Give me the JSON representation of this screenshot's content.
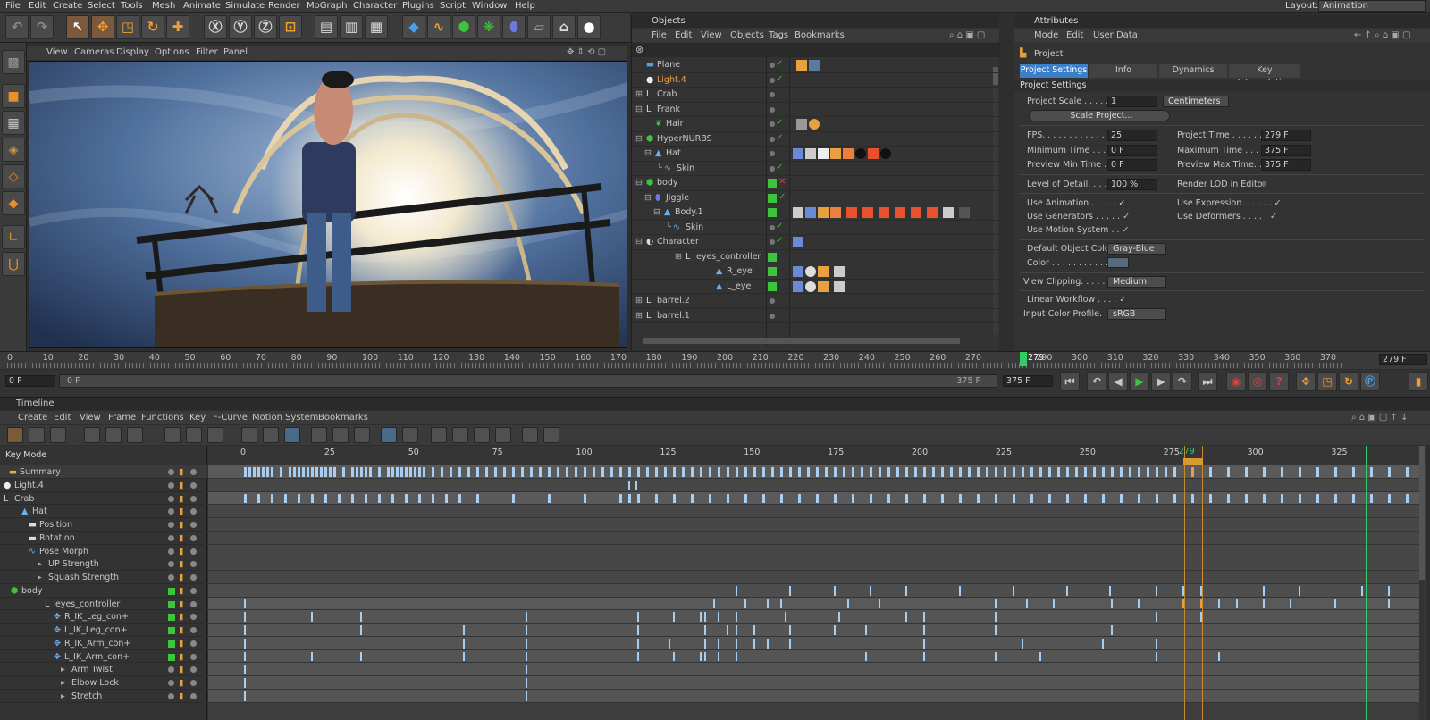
{
  "menu": {
    "items": [
      "File",
      "Edit",
      "Create",
      "Select",
      "Tools",
      "Mesh",
      "Animate",
      "Simulate",
      "Render",
      "MoGraph",
      "Character",
      "Plugins",
      "Script",
      "Window",
      "Help"
    ],
    "layout_label": "Layout:",
    "layout_value": "Animation"
  },
  "viewport": {
    "menu": [
      "View",
      "Cameras",
      "Display",
      "Options",
      "Filter",
      "Panel"
    ]
  },
  "objects": {
    "title": "Objects",
    "menu": [
      "File",
      "Edit",
      "View",
      "Objects",
      "Tags",
      "Bookmarks"
    ],
    "rows": [
      {
        "name": "Plane"
      },
      {
        "name": "Light.4"
      },
      {
        "name": "Crab"
      },
      {
        "name": "Frank"
      },
      {
        "name": "Hair"
      },
      {
        "name": "HyperNURBS"
      },
      {
        "name": "Hat"
      },
      {
        "name": "Skin"
      },
      {
        "name": "body"
      },
      {
        "name": "Jiggle"
      },
      {
        "name": "Body.1"
      },
      {
        "name": "Skin"
      },
      {
        "name": "Character"
      },
      {
        "name": "eyes_controller"
      },
      {
        "name": "R_eye"
      },
      {
        "name": "L_eye"
      },
      {
        "name": "barrel.2"
      },
      {
        "name": "barrel.1"
      }
    ]
  },
  "attributes": {
    "title": "Attributes",
    "menu": [
      "Mode",
      "Edit",
      "User Data"
    ],
    "object": "Project",
    "tabs": [
      "Project Settings",
      "Info",
      "Dynamics",
      "Key Interpolation"
    ],
    "section": "Project Settings",
    "project_scale_label": "Project Scale . . . . . . .",
    "project_scale": "1",
    "scale_unit": "Centimeters",
    "scale_button": "Scale Project...",
    "fps_label": "FPS. . . . . . . . . . . . . . .",
    "fps": "25",
    "min_time_label": "Minimum Time . . . . . .",
    "min_time": "0 F",
    "prev_min_label": "Preview Min Time . . .",
    "prev_min": "0 F",
    "proj_time_label": "Project Time . . . . . .",
    "proj_time": "279 F",
    "max_time_label": "Maximum Time . . . . .",
    "max_time": "375 F",
    "prev_max_label": "Preview Max Time. . .",
    "prev_max": "375 F",
    "lod_label": "Level of Detail. . . . . . .",
    "lod": "100 %",
    "render_lod_label": "Render LOD in Editor",
    "use_anim": "Use Animation . . . . . ✓",
    "use_gen": "Use Generators . . . . . ✓",
    "use_motion": "Use Motion System . . ✓",
    "use_expr": "Use Expression. . . . . . ✓",
    "use_def": "Use Deformers . . . . . ✓",
    "def_color_label": "Default Object Color",
    "def_color": "Gray-Blue",
    "color_label": "Color . . . . . . . . . . . . .",
    "view_clip_label": "View Clipping. . . . . . .",
    "view_clip": "Medium",
    "linear_label": "Linear Workflow . . . . ✓",
    "input_profile_label": "Input Color Profile. . .",
    "input_profile": "sRGB"
  },
  "ruler": {
    "ticks": [
      "0",
      "10",
      "20",
      "30",
      "40",
      "50",
      "60",
      "70",
      "80",
      "90",
      "100",
      "110",
      "120",
      "130",
      "140",
      "150",
      "160",
      "170",
      "180",
      "190",
      "200",
      "210",
      "220",
      "230",
      "240",
      "250",
      "260",
      "270",
      "279",
      "290",
      "300",
      "310",
      "320",
      "330",
      "340",
      "350",
      "360",
      "370"
    ],
    "frame": "279 F"
  },
  "slider": {
    "start": "0 F",
    "range_start": "0 F",
    "range_end": "375 F",
    "end": "375 F"
  },
  "timeline": {
    "title": "Timeline",
    "menu": [
      "Create",
      "Edit",
      "View",
      "Frame",
      "Functions",
      "Key",
      "F-Curve",
      "Motion System",
      "Bookmarks"
    ],
    "key_mode": "Key Mode",
    "ticks": [
      "0",
      "25",
      "50",
      "75",
      "100",
      "125",
      "150",
      "175",
      "200",
      "225",
      "250",
      "275",
      "279",
      "300",
      "325"
    ],
    "tracks": [
      {
        "name": "Summary"
      },
      {
        "name": "Light.4"
      },
      {
        "name": "Crab"
      },
      {
        "name": "Hat"
      },
      {
        "name": "Position"
      },
      {
        "name": "Rotation"
      },
      {
        "name": "Pose Morph"
      },
      {
        "name": "UP Strength"
      },
      {
        "name": "Squash Strength"
      },
      {
        "name": "body"
      },
      {
        "name": "eyes_controller"
      },
      {
        "name": "R_IK_Leg_con+"
      },
      {
        "name": "L_IK_Leg_con+"
      },
      {
        "name": "R_IK_Arm_con+"
      },
      {
        "name": "L_IK_Arm_con+"
      },
      {
        "name": "Arm Twist"
      },
      {
        "name": "Elbow Lock"
      },
      {
        "name": "Stretch"
      }
    ]
  },
  "colors": {
    "accent": "#3a7fc8",
    "active": "#e8a04a",
    "green": "#3cc43c",
    "playhead": "#33cc66"
  }
}
